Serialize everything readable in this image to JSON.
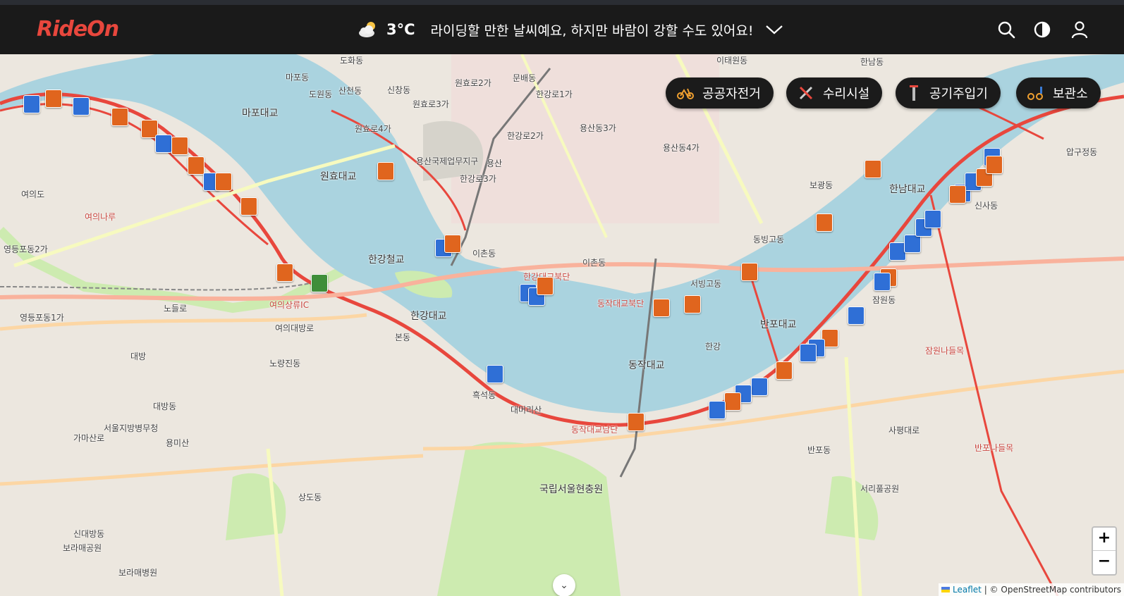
{
  "app": {
    "logo": "RideOn"
  },
  "weather": {
    "icon": "cloud-sun-icon",
    "temperature": "3°C",
    "message": "라이딩할 만한 날씨예요, 하지만 바람이 강할 수도 있어요!"
  },
  "header_icons": [
    "search-icon",
    "contrast-icon",
    "user-icon"
  ],
  "filters": [
    {
      "label": "공공자전거",
      "icon": "bicycle-icon"
    },
    {
      "label": "수리시설",
      "icon": "tools-icon"
    },
    {
      "label": "공기주입기",
      "icon": "pump-icon"
    },
    {
      "label": "보관소",
      "icon": "bike-storage-icon"
    }
  ],
  "map": {
    "labels": [
      "도화동",
      "마포동",
      "도원동",
      "신창동",
      "원효로2가",
      "문배동",
      "이태원동",
      "한남동",
      "한강로1가",
      "마포대교",
      "산천동",
      "원효로3가",
      "원효로4가",
      "한강로2가",
      "용산동3가",
      "여의도",
      "용산국제업무지구",
      "원효대교",
      "한강로3가",
      "용산",
      "용산동4가",
      "이촌동",
      "한강철교",
      "이촌동",
      "한강대교",
      "서빙고동",
      "동빙고동",
      "보광동",
      "한남대교",
      "신사동",
      "압구정동",
      "잠원동",
      "반포대교",
      "동작대교",
      "노량진동",
      "흑석동",
      "본동",
      "대방동",
      "상도동",
      "국립서울현충원",
      "반포동",
      "사평대로",
      "노들로",
      "영등포동2가",
      "영등포동1가",
      "여의대방로",
      "대방",
      "서울지방병무청",
      "가마산로",
      "신대방동",
      "보라매공원",
      "보라매병원",
      "서리풀공원",
      "잠원나들목",
      "반포나들목",
      "한강",
      "여의나루",
      "여의상류IC",
      "동작대교북단",
      "한강대교북단",
      "동작대교남단",
      "용미산",
      "대머리산"
    ],
    "colors": {
      "water": "#aad3df",
      "park": "#cdebb0",
      "motorway": "#e892a2",
      "trunk": "#f9b29c",
      "primary": "#fcd6a4",
      "secondary": "#f7fabf",
      "bike_route": "#e8473d"
    }
  },
  "zoom": {
    "in": "+",
    "out": "−"
  },
  "attribution": {
    "leaflet": "Leaflet",
    "rest": "| © OpenStreetMap contributors"
  }
}
